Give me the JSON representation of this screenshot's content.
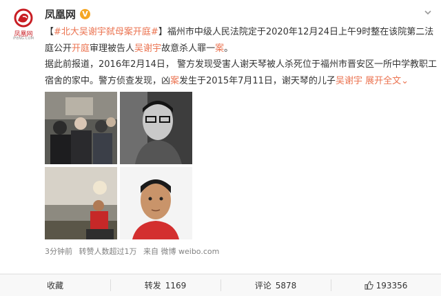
{
  "account": {
    "name": "凤凰网",
    "avatar_text": "凤凰网",
    "avatar_sub": "IFENG.COM",
    "verified_mark": "V"
  },
  "post": {
    "tag": "#北大吴谢宇弑母案开庭#",
    "segments": [
      {
        "text": "【",
        "style": "plain"
      },
      {
        "text": "#北大吴谢宇弑母案开庭#",
        "style": "link"
      },
      {
        "text": "】福州市中级人民法院定于2020年12月24日上午9时整在该院第二法庭公开",
        "style": "plain"
      },
      {
        "text": "开庭",
        "style": "hl"
      },
      {
        "text": "审理被告人",
        "style": "plain"
      },
      {
        "text": "吴谢宇",
        "style": "hl"
      },
      {
        "text": "故意杀人罪一",
        "style": "plain"
      },
      {
        "text": "案",
        "style": "hl"
      },
      {
        "text": "。",
        "style": "plain"
      }
    ],
    "segments2": [
      {
        "text": "据此前报道，2016年2月14日， 警方发现受害人谢天琴被人杀死位于福州市晋安区一所中学教职工宿舍的家中。警方侦查发现，凶",
        "style": "plain"
      },
      {
        "text": "案",
        "style": "hl"
      },
      {
        "text": "发生于2015年7月11日，谢天琴的儿子",
        "style": "plain"
      },
      {
        "text": "吴谢宇",
        "style": "hl"
      },
      {
        "text": " ",
        "style": "plain"
      },
      {
        "text": "展开全文",
        "style": "link"
      },
      {
        "text": "⌄",
        "style": "link"
      }
    ]
  },
  "meta": {
    "time": "3分钟前",
    "reposts": "转赞人数超过1万",
    "source": "来自 微博 weibo.com"
  },
  "actions": {
    "favorite": "收藏",
    "repost_label": "转发",
    "repost_count": "1169",
    "comment_label": "评论",
    "comment_count": "5878",
    "like_count": "193356"
  },
  "colors": {
    "link": "#eb7350",
    "brand_red": "#c81e24",
    "verified": "#f5a623"
  }
}
